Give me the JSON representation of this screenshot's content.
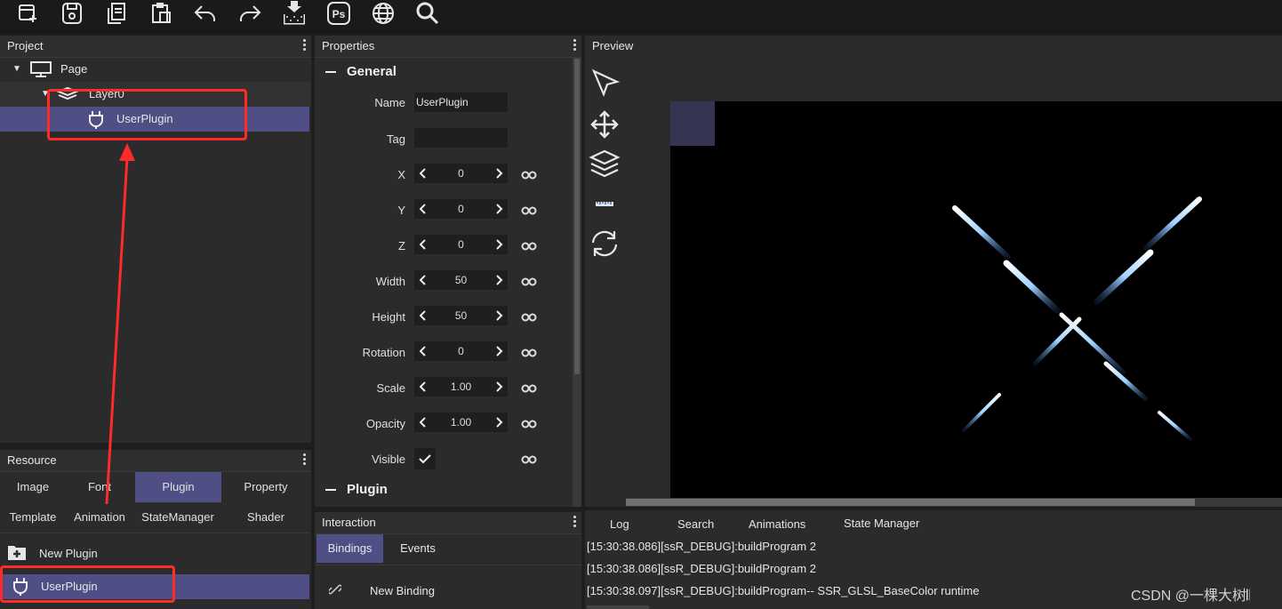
{
  "toolbar": {
    "icons": [
      "new-file-icon",
      "save-icon",
      "copy-icon",
      "paste-icon",
      "undo-icon",
      "redo-icon",
      "export-icon",
      "photoshop-icon",
      "globe-icon",
      "search-icon"
    ],
    "ps_label": "Ps"
  },
  "project": {
    "title": "Project",
    "tree": {
      "page": "Page",
      "layer": "Layer0",
      "plugin": "UserPlugin"
    }
  },
  "properties": {
    "title": "Properties",
    "general_label": "General",
    "plugin_label": "Plugin",
    "name_label": "Name",
    "name_value": "UserPlugin",
    "tag_label": "Tag",
    "tag_value": "",
    "fields": [
      {
        "label": "X",
        "value": "0"
      },
      {
        "label": "Y",
        "value": "0"
      },
      {
        "label": "Z",
        "value": "0"
      },
      {
        "label": "Width",
        "value": "50"
      },
      {
        "label": "Height",
        "value": "50"
      },
      {
        "label": "Rotation",
        "value": "0"
      },
      {
        "label": "Scale",
        "value": "1.00"
      },
      {
        "label": "Opacity",
        "value": "1.00"
      }
    ],
    "visible_label": "Visible",
    "visible_checked": true
  },
  "preview": {
    "title": "Preview",
    "tools": [
      "pointer-icon",
      "move-icon",
      "layers-icon",
      "ruler-icon",
      "refresh-icon"
    ]
  },
  "resource": {
    "title": "Resource",
    "tabs": [
      "Image",
      "Font",
      "Plugin",
      "Property",
      "Template",
      "Animation",
      "StateManager",
      "Shader"
    ],
    "selected_tab": "Plugin",
    "new_label": "New Plugin",
    "item_label": "UserPlugin"
  },
  "interaction": {
    "title": "Interaction",
    "tabs": [
      "Bindings",
      "Events"
    ],
    "new_binding": "New Binding"
  },
  "log": {
    "tabs": [
      "Log",
      "Search",
      "Animations",
      "State Manager"
    ],
    "lines": [
      "[15:30:38.086][ssR_DEBUG]:buildProgram 2",
      "[15:30:38.086][ssR_DEBUG]:buildProgram 2",
      "[15:30:38.097][ssR_DEBUG]:buildProgram-- SSR_GLSL_BaseColor  runtime"
    ]
  },
  "watermark": "CSDN @一棵大树𝄃",
  "colors": {
    "selection": "#4f4f86",
    "highlight": "#ff2a2a",
    "panel": "#2b2b2b"
  }
}
